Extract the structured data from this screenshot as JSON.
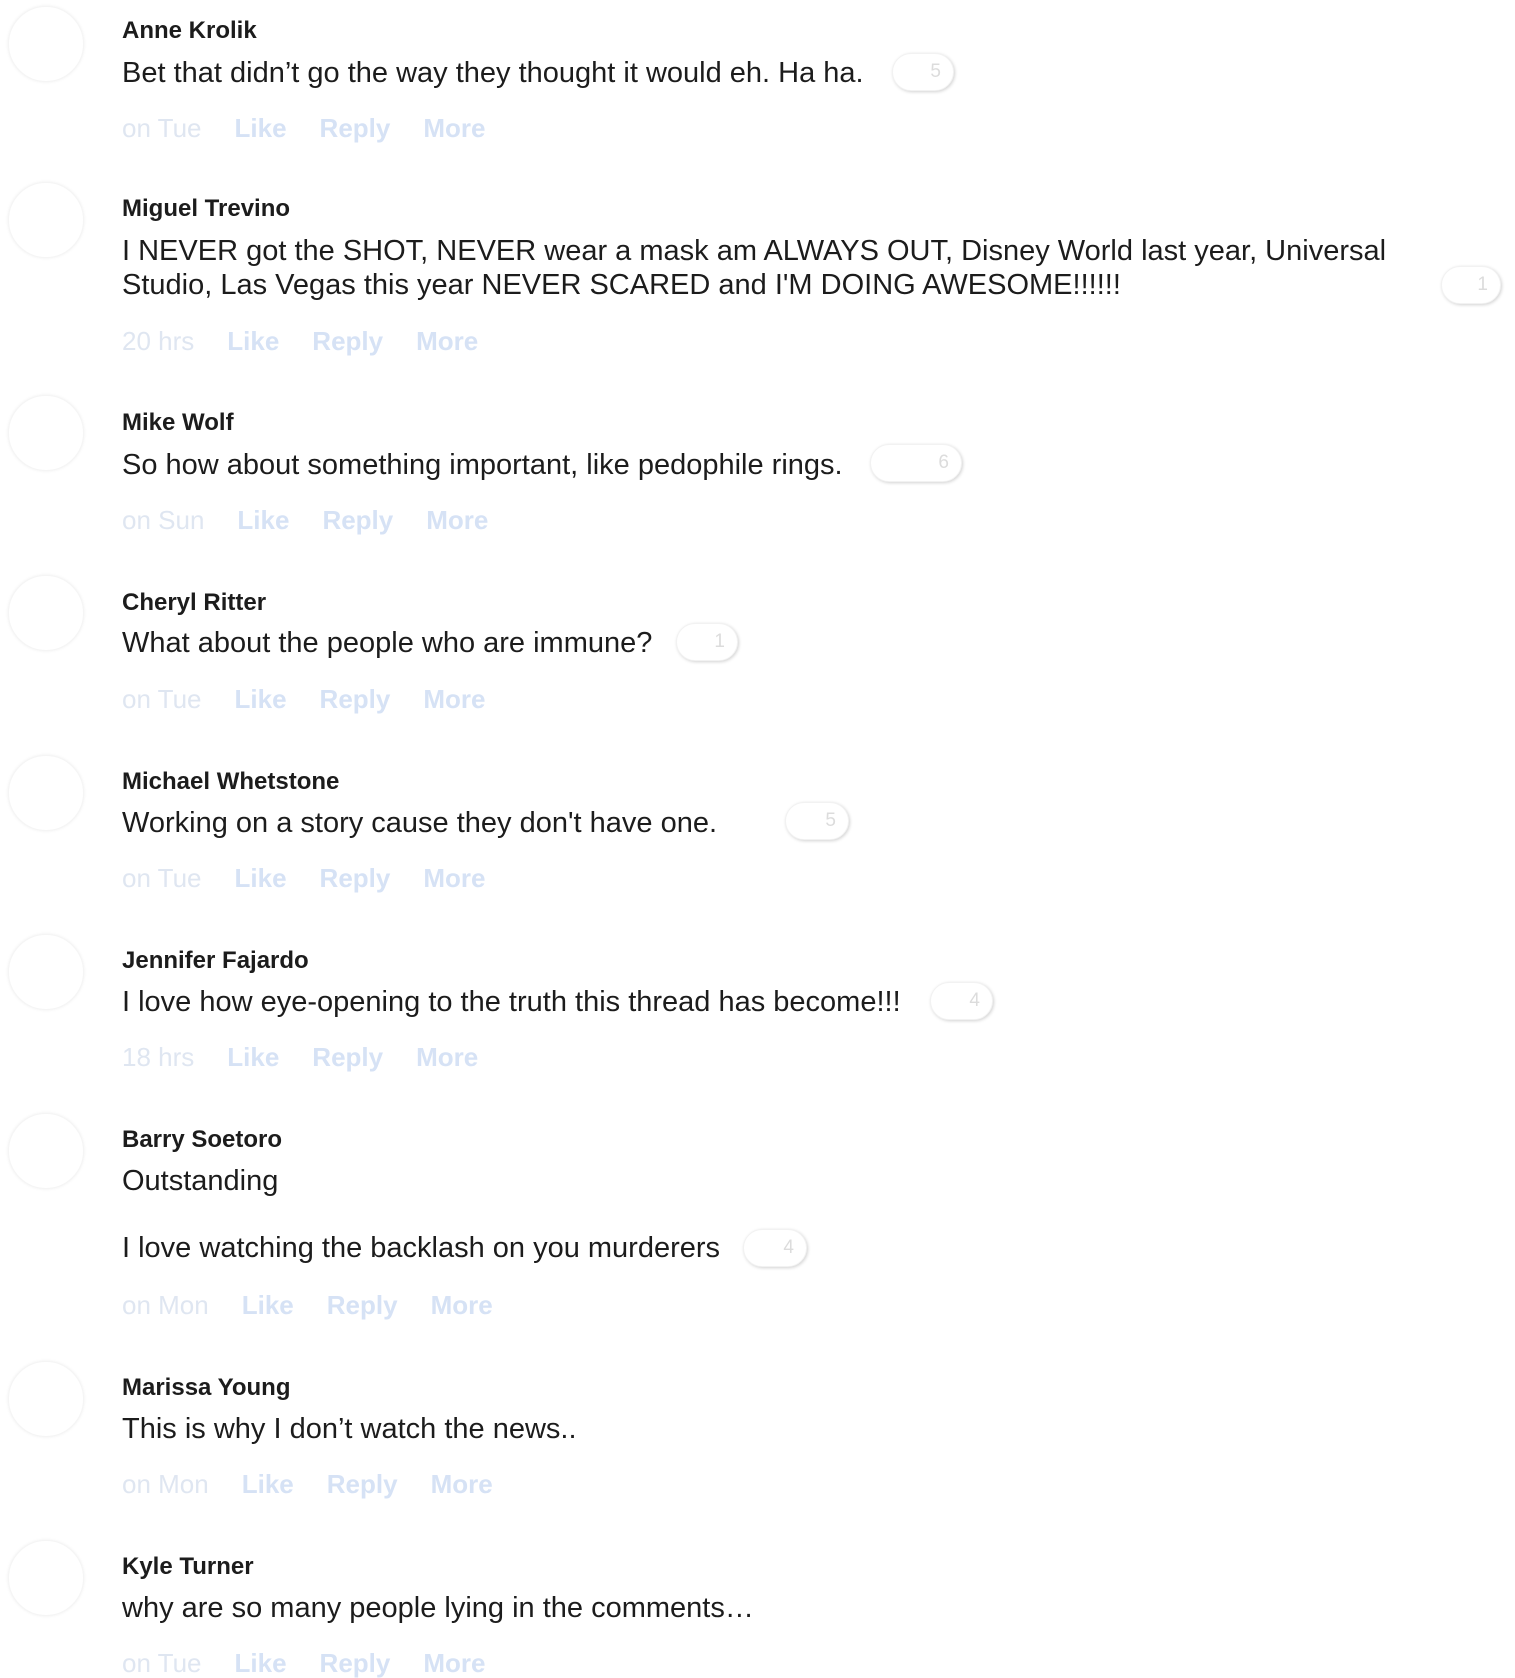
{
  "comments": [
    {
      "author": "Anne Krolik",
      "lines": [
        "Bet that didn’t go the way they thought it would eh. Ha ha."
      ],
      "reactions": "5",
      "time": "on Tue",
      "like": "Like",
      "reply": "Reply",
      "more": "More"
    },
    {
      "author": "Miguel Trevino",
      "lines": [
        "I NEVER got the SHOT, NEVER wear a mask am ALWAYS OUT, Disney World last year, Universal",
        "Studio, Las Vegas this year NEVER SCARED and I'M DOING AWESOME!!!!!!"
      ],
      "reactions": "1",
      "time": "20 hrs",
      "like": "Like",
      "reply": "Reply",
      "more": "More"
    },
    {
      "author": "Mike Wolf",
      "lines": [
        "So how about something important, like pedophile rings."
      ],
      "reactions": "6",
      "time": "on Sun",
      "like": "Like",
      "reply": "Reply",
      "more": "More"
    },
    {
      "author": "Cheryl Ritter",
      "lines": [
        "What about the people who are immune?"
      ],
      "reactions": "1",
      "time": "on Tue",
      "like": "Like",
      "reply": "Reply",
      "more": "More"
    },
    {
      "author": "Michael Whetstone",
      "lines": [
        "Working on a story cause they don't have one."
      ],
      "reactions": "5",
      "time": "on Tue",
      "like": "Like",
      "reply": "Reply",
      "more": "More"
    },
    {
      "author": "Jennifer Fajardo",
      "lines": [
        "I love how eye-opening to the truth this thread has become!!!"
      ],
      "reactions": "4",
      "time": "18 hrs",
      "like": "Like",
      "reply": "Reply",
      "more": "More"
    },
    {
      "author": "Barry Soetoro",
      "lines": [
        "Outstanding",
        "I love watching the backlash on you murderers"
      ],
      "reactions": "4",
      "time": "on Mon",
      "like": "Like",
      "reply": "Reply",
      "more": "More"
    },
    {
      "author": "Marissa Young",
      "lines": [
        "This is why I don’t watch the news.."
      ],
      "time": "on Mon",
      "like": "Like",
      "reply": "Reply",
      "more": "More"
    },
    {
      "author": "Kyle Turner",
      "lines": [
        "why are so many people lying in the comments…"
      ],
      "time": "on Tue",
      "like": "Like",
      "reply": "Reply",
      "more": "More"
    }
  ]
}
